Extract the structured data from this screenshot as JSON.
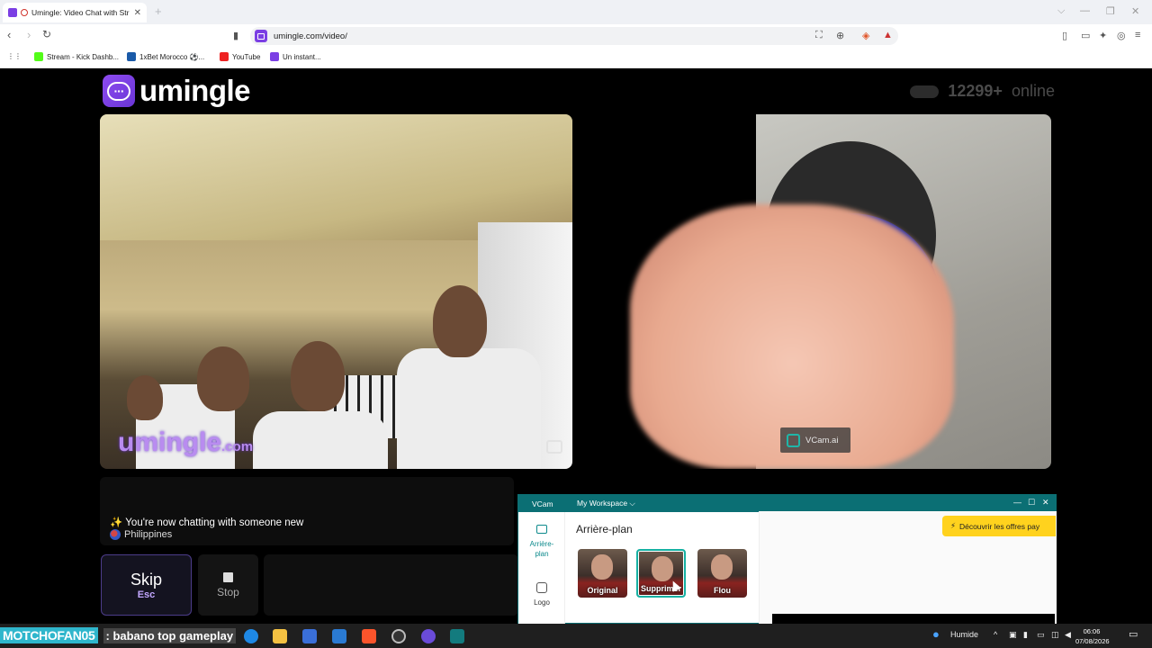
{
  "browser": {
    "tab_title": "Umingle: Video Chat with Str",
    "url": "umingle.com/video/",
    "bookmarks": [
      "Stream - Kick Dashb...",
      "1xBet Morocco ⚽...",
      "YouTube",
      "Un instant..."
    ]
  },
  "site": {
    "logo": "umingle",
    "online_count": "12299+",
    "online_label": "online",
    "watermark_main": "umingle",
    "watermark_tld": ".com",
    "vcam_tag": "VCam.ai"
  },
  "status": {
    "line1": "✨ You're now chatting with someone new",
    "country": "Philippines"
  },
  "buttons": {
    "skip": "Skip",
    "skip_key": "Esc",
    "stop": "Stop"
  },
  "vcam": {
    "app": "VCam",
    "workspace": "My Workspace ⌵",
    "side_background": "Arrière-plan",
    "side_logo": "Logo",
    "heading": "Arrière-plan",
    "thumbs": [
      "Original",
      "Supprimer",
      "Flou"
    ],
    "promo": "Découvrir les offres pay"
  },
  "taskbar": {
    "ticker_user": "MOTCHOFAN05",
    "ticker_msg": ": babano top gameplay",
    "weather": "Humide",
    "time": "06:06",
    "date": "07/08/2026"
  }
}
